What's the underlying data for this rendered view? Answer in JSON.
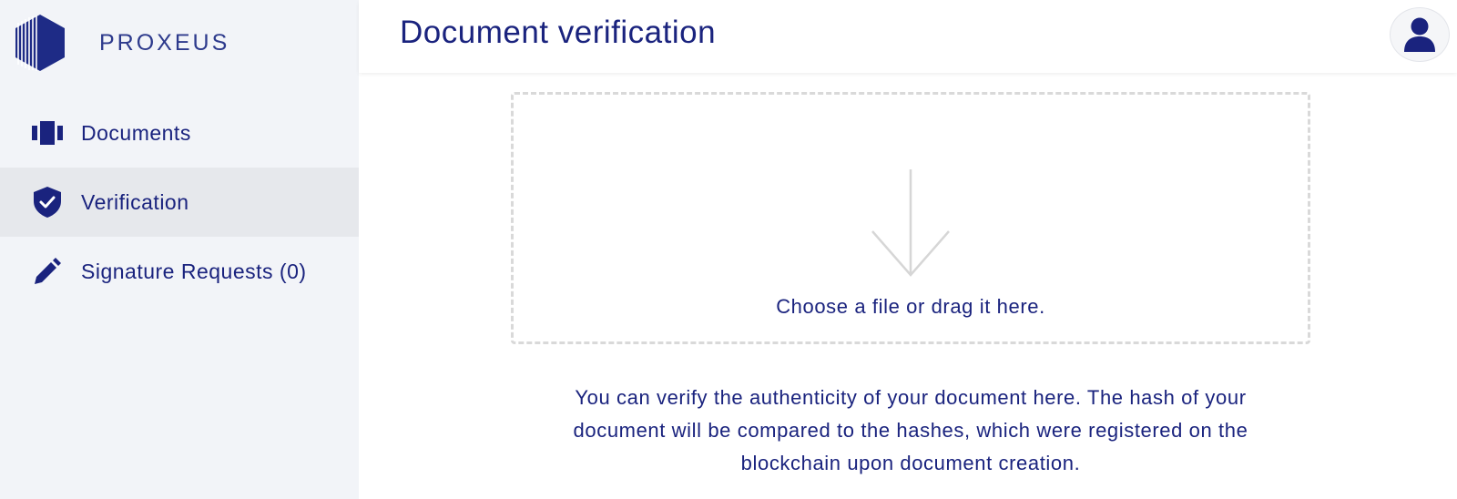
{
  "app": {
    "brand": "PROXEUS",
    "colors": {
      "primary": "#1a237e",
      "sidebar_bg": "#f2f4f8",
      "active_bg": "#e6e8ec",
      "dashed_border": "#d9d9d9"
    }
  },
  "sidebar": {
    "items": [
      {
        "label": "Documents",
        "icon": "documents-icon",
        "active": false
      },
      {
        "label": "Verification",
        "icon": "shield-check-icon",
        "active": true
      },
      {
        "label": "Signature Requests (0)",
        "icon": "pen-icon",
        "active": false
      }
    ]
  },
  "header": {
    "title": "Document verification",
    "avatar_icon": "user-icon"
  },
  "main": {
    "dropzone_text": "Choose a file or drag it here.",
    "dropzone_icon": "arrow-down-icon",
    "description": "You can verify the authenticity of your document here. The hash of your document will be compared to the hashes, which were registered on the blockchain upon document creation."
  }
}
